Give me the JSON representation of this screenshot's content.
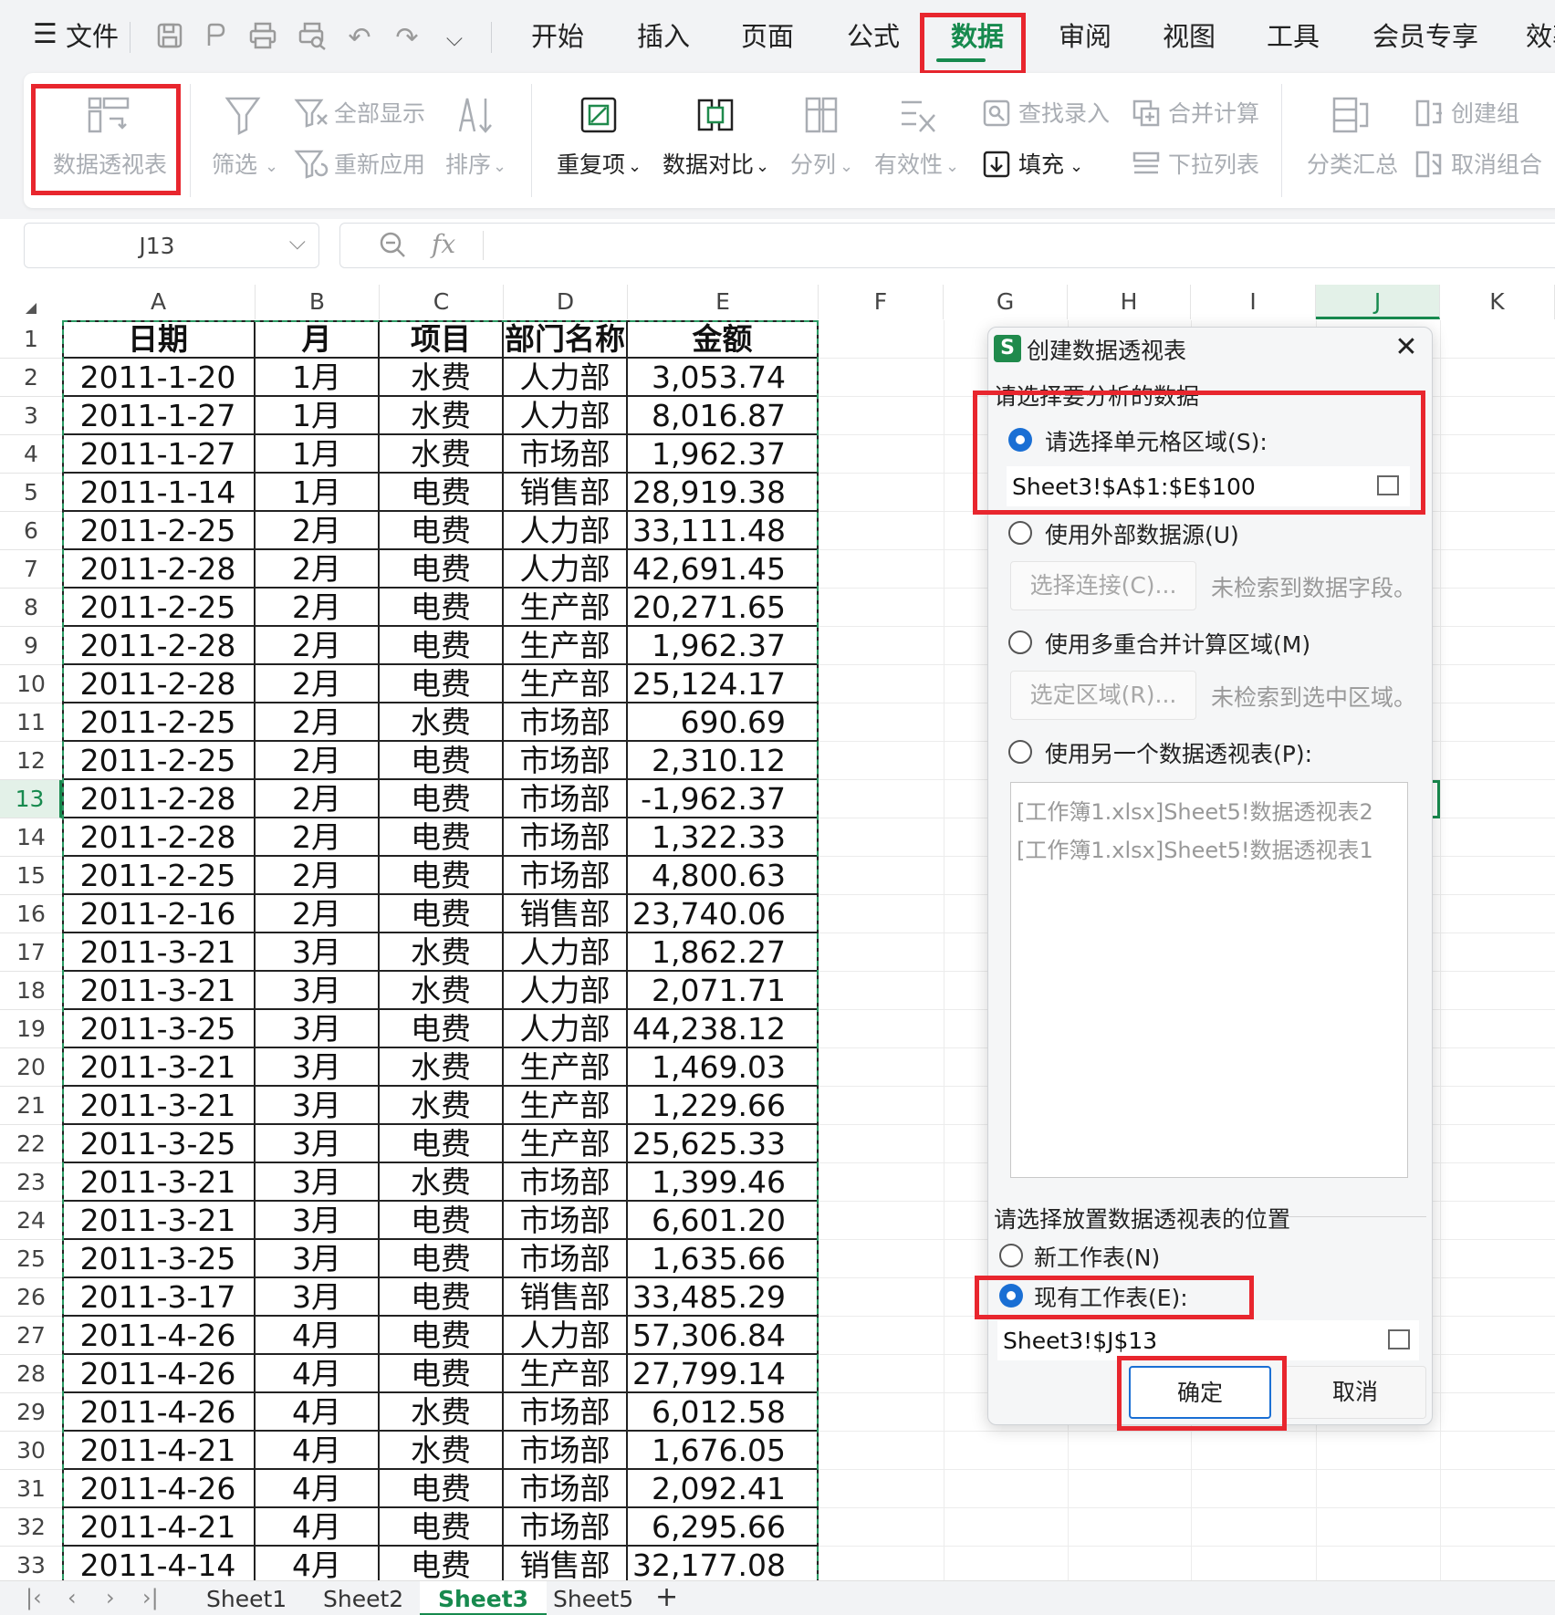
{
  "menubar": {
    "file_label": "文件",
    "tabs": [
      "开始",
      "插入",
      "页面",
      "公式",
      "数据",
      "审阅",
      "视图",
      "工具",
      "会员专享",
      "效率"
    ],
    "active_tab": "数据"
  },
  "ribbon": {
    "pivot_table": "数据透视表",
    "filter": "筛选",
    "show_all": "全部显示",
    "reapply": "重新应用",
    "sort": "排序",
    "duplicates": "重复项",
    "compare": "数据对比",
    "split": "分列",
    "validity": "有效性",
    "find_entry": "查找录入",
    "fill": "填充",
    "consolidate": "合并计算",
    "dropdown_list": "下拉列表",
    "subtotal": "分类汇总",
    "group": "创建组",
    "ungroup": "取消组合"
  },
  "formula_bar": {
    "name_box": "J13",
    "fx": "fx",
    "value": ""
  },
  "grid": {
    "columns": [
      "A",
      "B",
      "C",
      "D",
      "E",
      "F",
      "G",
      "H",
      "I",
      "J",
      "K"
    ],
    "active_column": "J",
    "active_row": 13,
    "headers": [
      "日期",
      "月",
      "项目",
      "部门名称",
      "金额"
    ],
    "rows": [
      [
        "2011-1-20",
        "1月",
        "水费",
        "人力部",
        "3,053.74"
      ],
      [
        "2011-1-27",
        "1月",
        "水费",
        "人力部",
        "8,016.87"
      ],
      [
        "2011-1-27",
        "1月",
        "水费",
        "市场部",
        "1,962.37"
      ],
      [
        "2011-1-14",
        "1月",
        "电费",
        "销售部",
        "28,919.38"
      ],
      [
        "2011-2-25",
        "2月",
        "电费",
        "人力部",
        "33,111.48"
      ],
      [
        "2011-2-28",
        "2月",
        "电费",
        "人力部",
        "42,691.45"
      ],
      [
        "2011-2-25",
        "2月",
        "电费",
        "生产部",
        "20,271.65"
      ],
      [
        "2011-2-28",
        "2月",
        "电费",
        "生产部",
        "1,962.37"
      ],
      [
        "2011-2-28",
        "2月",
        "电费",
        "生产部",
        "25,124.17"
      ],
      [
        "2011-2-25",
        "2月",
        "水费",
        "市场部",
        "690.69"
      ],
      [
        "2011-2-25",
        "2月",
        "电费",
        "市场部",
        "2,310.12"
      ],
      [
        "2011-2-28",
        "2月",
        "电费",
        "市场部",
        "-1,962.37"
      ],
      [
        "2011-2-28",
        "2月",
        "电费",
        "市场部",
        "1,322.33"
      ],
      [
        "2011-2-25",
        "2月",
        "电费",
        "市场部",
        "4,800.63"
      ],
      [
        "2011-2-16",
        "2月",
        "电费",
        "销售部",
        "23,740.06"
      ],
      [
        "2011-3-21",
        "3月",
        "水费",
        "人力部",
        "1,862.27"
      ],
      [
        "2011-3-21",
        "3月",
        "水费",
        "人力部",
        "2,071.71"
      ],
      [
        "2011-3-25",
        "3月",
        "电费",
        "人力部",
        "44,238.12"
      ],
      [
        "2011-3-21",
        "3月",
        "水费",
        "生产部",
        "1,469.03"
      ],
      [
        "2011-3-21",
        "3月",
        "水费",
        "生产部",
        "1,229.66"
      ],
      [
        "2011-3-25",
        "3月",
        "电费",
        "生产部",
        "25,625.33"
      ],
      [
        "2011-3-21",
        "3月",
        "水费",
        "市场部",
        "1,399.46"
      ],
      [
        "2011-3-21",
        "3月",
        "电费",
        "市场部",
        "6,601.20"
      ],
      [
        "2011-3-25",
        "3月",
        "电费",
        "市场部",
        "1,635.66"
      ],
      [
        "2011-3-17",
        "3月",
        "电费",
        "销售部",
        "33,485.29"
      ],
      [
        "2011-4-26",
        "4月",
        "电费",
        "人力部",
        "57,306.84"
      ],
      [
        "2011-4-26",
        "4月",
        "电费",
        "生产部",
        "27,799.14"
      ],
      [
        "2011-4-26",
        "4月",
        "水费",
        "市场部",
        "6,012.58"
      ],
      [
        "2011-4-21",
        "4月",
        "水费",
        "市场部",
        "1,676.05"
      ],
      [
        "2011-4-26",
        "4月",
        "电费",
        "市场部",
        "2,092.41"
      ],
      [
        "2011-4-21",
        "4月",
        "电费",
        "市场部",
        "6,295.66"
      ],
      [
        "2011-4-14",
        "4月",
        "电费",
        "销售部",
        "32,177.08"
      ]
    ]
  },
  "sheets": {
    "tabs": [
      "Sheet1",
      "Sheet2",
      "Sheet3",
      "Sheet5"
    ],
    "active": "Sheet3"
  },
  "dialog": {
    "logo": "S",
    "title": "创建数据透视表",
    "section_select": "请选择要分析的数据",
    "opt_range": "请选择单元格区域(S):",
    "range_value": "Sheet3!$A$1:$E$100",
    "opt_external": "使用外部数据源(U)",
    "choose_connection": "选择连接(C)...",
    "no_fields": "未检索到数据字段。",
    "opt_multi": "使用多重合并计算区域(M)",
    "choose_region": "选定区域(R)...",
    "no_region": "未检索到选中区域。",
    "opt_other_pivot": "使用另一个数据透视表(P):",
    "pivot_list": [
      "[工作簿1.xlsx]Sheet5!数据透视表2",
      "[工作簿1.xlsx]Sheet5!数据透视表1"
    ],
    "section_place": "请选择放置数据透视表的位置",
    "opt_new_sheet": "新工作表(N)",
    "opt_existing_sheet": "现有工作表(E):",
    "location_value": "Sheet3!$J$13",
    "ok": "确定",
    "cancel": "取消"
  },
  "colors": {
    "accent_green": "#178a4e",
    "highlight_red": "#e8262e",
    "radio_blue": "#1a6fd4"
  }
}
